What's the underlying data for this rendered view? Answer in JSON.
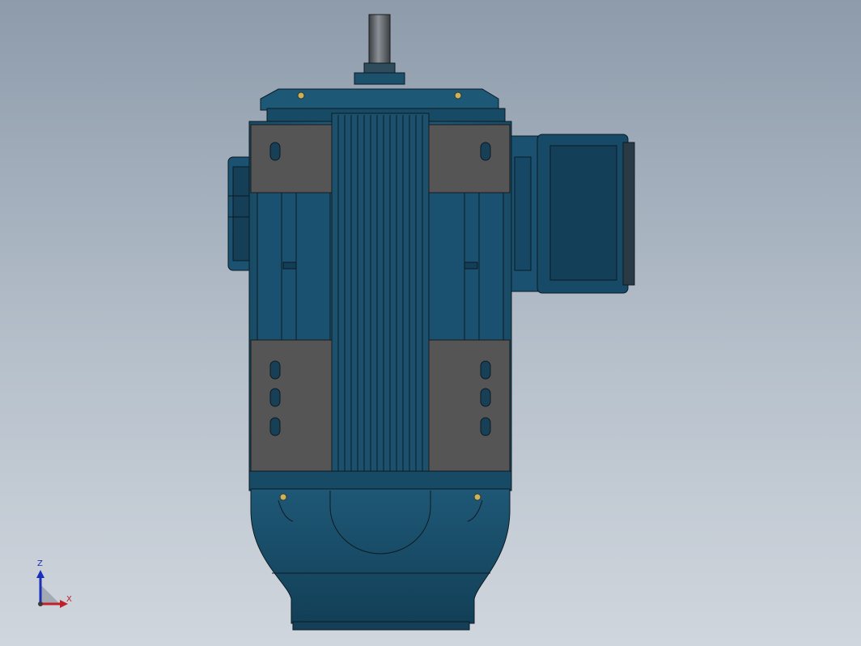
{
  "view": {
    "part": "motor",
    "colors": {
      "background_top": "#8d9bab",
      "background_bottom": "#d0d6dd",
      "body_blue": "#1f5a78",
      "dark_blue": "#123f57",
      "pad_gray": "#545454",
      "edge": "#0d1a22"
    }
  },
  "triad": {
    "z_label": "Z",
    "x_label": "X",
    "z_color": "#1c2fb8",
    "x_color": "#c0202a"
  }
}
